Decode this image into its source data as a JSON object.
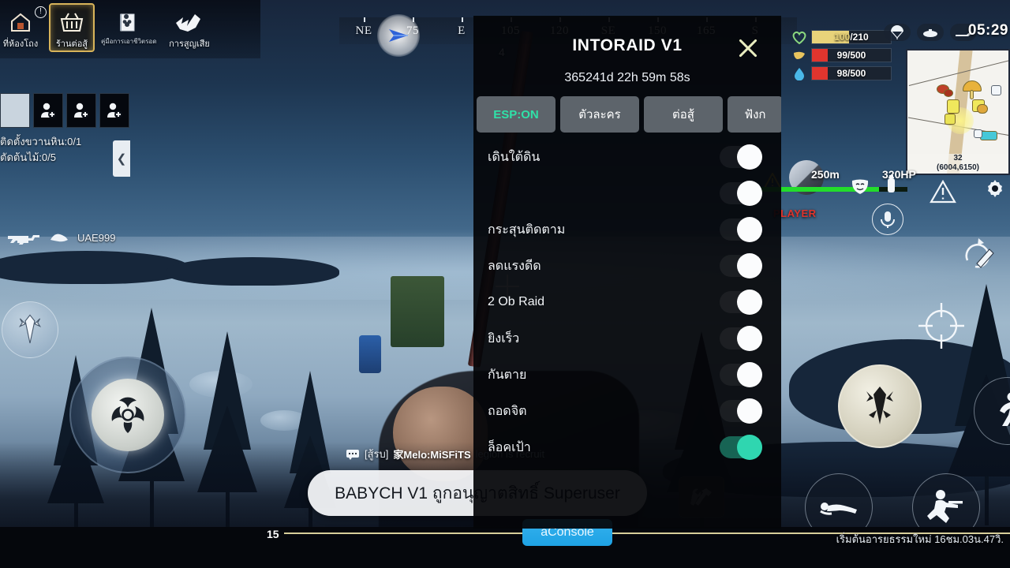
{
  "top_nav": {
    "items": [
      {
        "name": "dungeon-room",
        "label": "ที่ห้องโถง",
        "icon": "house-icon",
        "selected": false
      },
      {
        "name": "combat-shop",
        "label": "ร้านต่อสู้",
        "icon": "shop-basket-icon",
        "selected": true
      },
      {
        "name": "survival-guide",
        "label": "คู่มือการเอาชีวิตรอด",
        "icon": "book-icon",
        "selected": false
      },
      {
        "name": "losses",
        "label": "การสูญเสีย",
        "icon": "explosion-icon",
        "selected": false
      }
    ],
    "badge": "!"
  },
  "quests": {
    "slot_count": 4,
    "lines": [
      "ติดตั้งขวานหิน:0/1",
      "ตัดต้นไม้:0/5"
    ],
    "collapse_icon": "chevron-left-icon"
  },
  "weapon": {
    "icon": "rifle-icon",
    "ammo_icon": "ammo-icon",
    "name": "UAE999"
  },
  "compass": {
    "ticks": [
      "NE",
      "75",
      "E",
      "105",
      "120",
      "SE",
      "150",
      "165",
      "S"
    ],
    "count": "4",
    "marker_icon": "waypoint-icon"
  },
  "vitals": [
    {
      "name": "health",
      "icon": "heart-icon",
      "current": "100",
      "max": "210",
      "text": "100/210",
      "fill_pct": 47,
      "fill_color": "#e8d37a",
      "icon_color": "#8bd87f"
    },
    {
      "name": "food",
      "icon": "food-icon",
      "current": "99",
      "max": "500",
      "text": "99/500",
      "fill_pct": 20,
      "fill_color": "#e0352e",
      "icon_color": "#e8c45e"
    },
    {
      "name": "water",
      "icon": "water-drop-icon",
      "current": "98",
      "max": "500",
      "text": "98/500",
      "fill_pct": 20,
      "fill_color": "#e0352e",
      "icon_color": "#4ab8e8"
    }
  ],
  "top_right": {
    "icons": [
      "parachute-icon",
      "submarine-icon",
      "vehicle-icon"
    ],
    "clock": "05:29"
  },
  "minimap": {
    "level": "32",
    "coords": "(6004,6150)"
  },
  "esp_overlay": {
    "distance": "250m",
    "hp": "320HP",
    "label": "PLAYER",
    "hp_pct": 82,
    "warn_icon": "warning-triangle-icon",
    "mask_icon": "mask-icon",
    "item_icon": "spray-icon"
  },
  "right_icons": {
    "warning": "warning-triangle-icon",
    "gear": "gear-icon",
    "reload": "reload-icon",
    "mic": "mic-icon",
    "aim": "aim-reticle-icon"
  },
  "action_buttons": [
    {
      "name": "fire-main-button",
      "icon": "bullet-icon"
    },
    {
      "name": "fire-secondary-button",
      "icon": "bullet-icon"
    },
    {
      "name": "run-button",
      "icon": "running-man-icon"
    },
    {
      "name": "prone-button",
      "icon": "prone-man-icon"
    },
    {
      "name": "crouch-button",
      "icon": "crouch-shooter-icon"
    }
  ],
  "joystick": {
    "icon": "biohazard-icon"
  },
  "chat": {
    "icon": "chat-bubble-icon",
    "channel": "[สู้รบ]",
    "sender": "家Melo:MiSFiTS",
    "message": "legion is recruit"
  },
  "toast": {
    "message": "BABYCH V1 ถูกอนุญาตสิทธิ์ Superuser"
  },
  "tool_button": {
    "icon": "wrench-hammer-icon"
  },
  "bottom": {
    "number": "15",
    "console_label": "aConsole",
    "civilization_timer": "เริ่มต้นอารยธรรมใหม่ 16ชม.03น.47วิ."
  },
  "cheat_panel": {
    "title": "INTORAID V1",
    "timer": "365241d 22h 59m 58s",
    "close_icon": "close-x-icon",
    "tabs": [
      {
        "label": "ESP:ON",
        "active": true
      },
      {
        "label": "ตัวละคร",
        "active": false
      },
      {
        "label": "ต่อสู้",
        "active": false
      },
      {
        "label": "ฟังก",
        "active": false
      }
    ],
    "options": [
      {
        "label": "เดินใต้ดิน",
        "enabled": false
      },
      {
        "label": "",
        "enabled": false
      },
      {
        "label": "กระสุนติดตาม",
        "enabled": false
      },
      {
        "label": "ลดแรงดีด",
        "enabled": false
      },
      {
        "label": "2 Ob Raid",
        "enabled": false
      },
      {
        "label": "ยิงเร็ว",
        "enabled": false
      },
      {
        "label": "กันตาย",
        "enabled": false
      },
      {
        "label": "ถอดจิต",
        "enabled": false
      },
      {
        "label": "ล็อคเป้า",
        "enabled": true
      }
    ]
  },
  "colors": {
    "accent_green": "#2fe2a8",
    "console_blue": "#1ea2e4",
    "selected_gold": "#d8b45a",
    "enemy_red": "#e0332b"
  }
}
